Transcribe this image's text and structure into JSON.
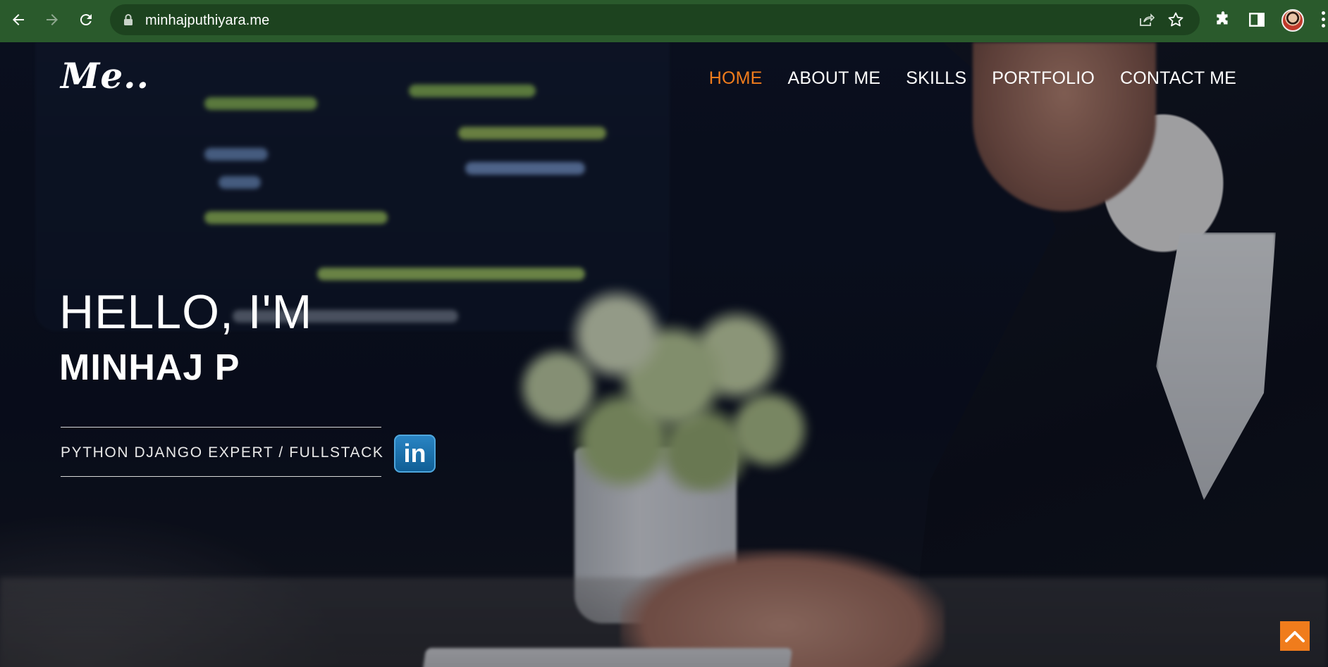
{
  "browser": {
    "url": "minhajputhiyara.me",
    "icons": [
      "back-icon",
      "forward-icon",
      "reload-icon",
      "lock-icon",
      "share-icon",
      "star-icon",
      "extensions-icon",
      "side-panel-icon",
      "profile-avatar",
      "menu-icon"
    ]
  },
  "site": {
    "logo": "Me..",
    "nav": [
      {
        "label": "HOME",
        "active": true
      },
      {
        "label": "ABOUT ME",
        "active": false
      },
      {
        "label": "SKILLS",
        "active": false
      },
      {
        "label": "PORTFOLIO",
        "active": false
      },
      {
        "label": "CONTACT ME",
        "active": false
      }
    ],
    "greeting": "HELLO, I'M",
    "name": "MINHAJ P",
    "role": "PYTHON DJANGO EXPERT / FULLSTACK",
    "linkedin_label": "in"
  },
  "colors": {
    "accent": "#f07c1c",
    "chrome_bg": "#2a5a2c",
    "omnibox_bg": "#1d431f"
  }
}
